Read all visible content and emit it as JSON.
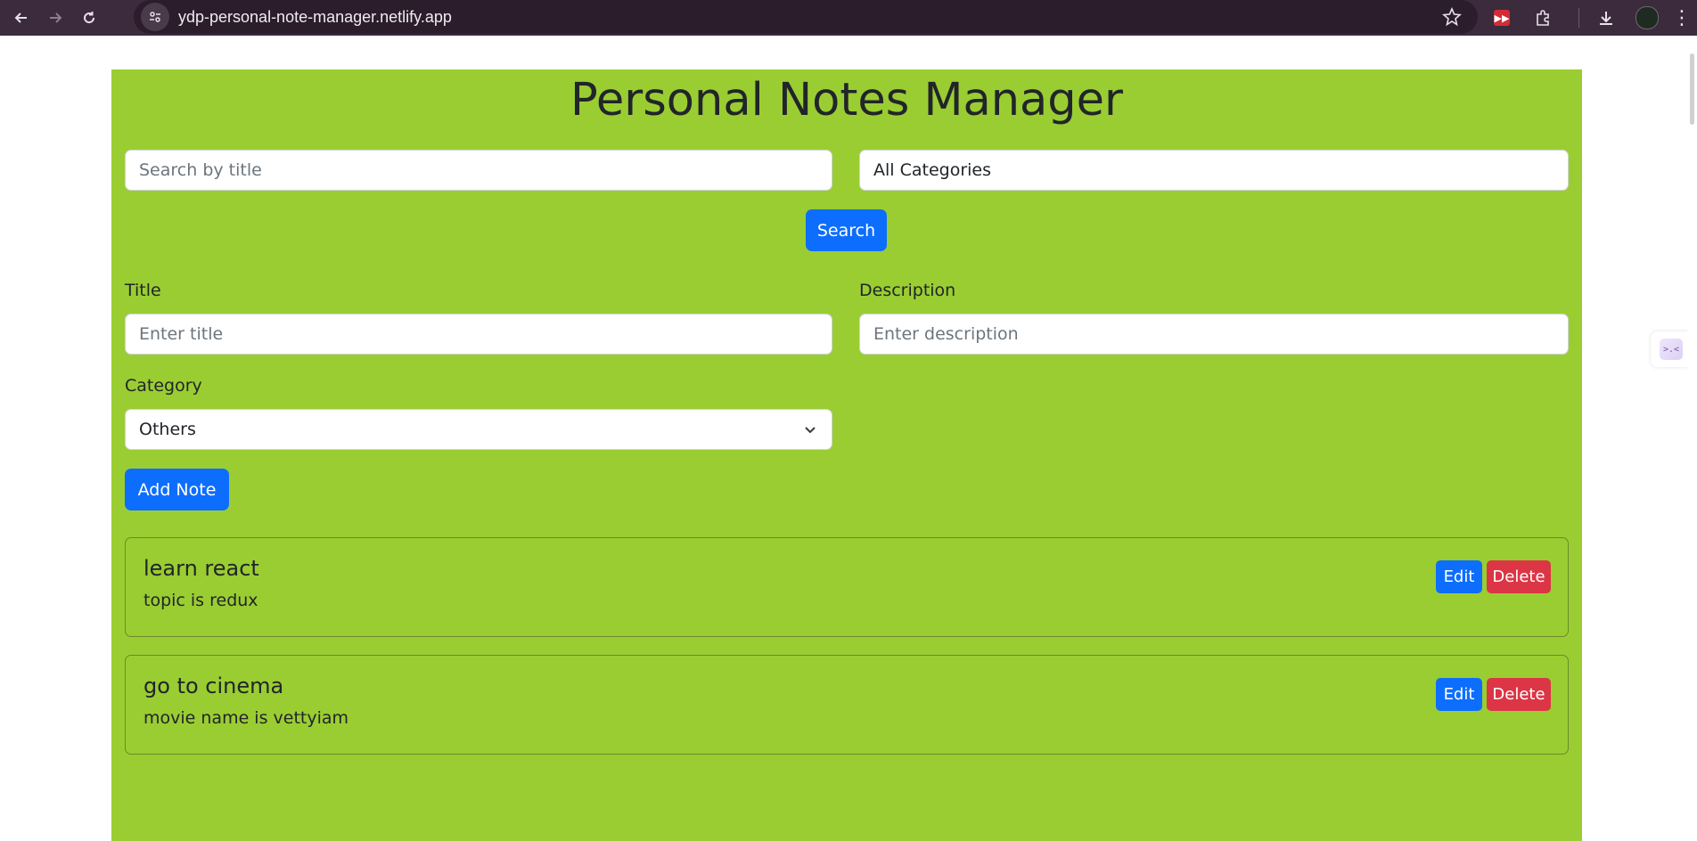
{
  "browser": {
    "url": "ydp-personal-note-manager.netlify.app",
    "icons": [
      "back-icon",
      "forward-icon",
      "reload-icon",
      "site-info-icon",
      "star-icon",
      "extension-icon",
      "puzzle-icon",
      "download-icon",
      "profile-avatar",
      "more-icon"
    ]
  },
  "page": {
    "title": "Personal Notes Manager",
    "background": "#9acd32",
    "search": {
      "placeholder": "Search by title",
      "value": ""
    },
    "category_filter": {
      "value": "All Categories"
    },
    "search_button": "Search",
    "form": {
      "title_label": "Title",
      "title_placeholder": "Enter title",
      "description_label": "Description",
      "description_placeholder": "Enter description",
      "category_label": "Category",
      "category_value": "Others",
      "add_button": "Add Note"
    },
    "notes": [
      {
        "title": "learn react",
        "description": "topic is redux",
        "edit": "Edit",
        "delete": "Delete"
      },
      {
        "title": "go to cinema",
        "description": "movie name is vettyiam",
        "edit": "Edit",
        "delete": "Delete"
      }
    ],
    "colors": {
      "primary": "#0d6efd",
      "danger": "#dc3545"
    }
  }
}
